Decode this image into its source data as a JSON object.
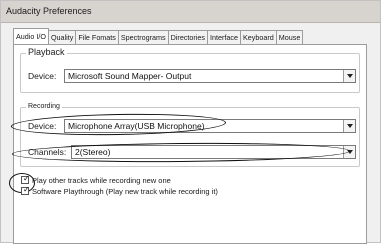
{
  "window": {
    "title": "Audacity Preferences"
  },
  "tabs": [
    {
      "label": "Audio I/O",
      "active": true
    },
    {
      "label": "Quality",
      "active": false
    },
    {
      "label": "File Fomats",
      "active": false
    },
    {
      "label": "Spectrograms",
      "active": false
    },
    {
      "label": "Directories",
      "active": false
    },
    {
      "label": "Interface",
      "active": false
    },
    {
      "label": "Keyboard",
      "active": false
    },
    {
      "label": "Mouse",
      "active": false
    }
  ],
  "playback": {
    "title": "Playback",
    "device_label": "Device:",
    "device_value": "Microsoft Sound Mapper- Output"
  },
  "recording": {
    "title": "Recording",
    "device_label": "Device:",
    "device_value": "Microphone Array(USB Microphone)",
    "channels_label": "Channels:",
    "channels_value": "2(Stereo)"
  },
  "options": {
    "play_other_tracks": {
      "label": "Play other tracks while recording new one",
      "checked": true
    },
    "software_playthrough": {
      "label": "Software Playthrough (Play new track while recording it)",
      "checked": true
    }
  },
  "colors": {
    "annotation": "#111111",
    "window_bg": "#f0f0f0",
    "panel_bg": "#ffffff"
  }
}
